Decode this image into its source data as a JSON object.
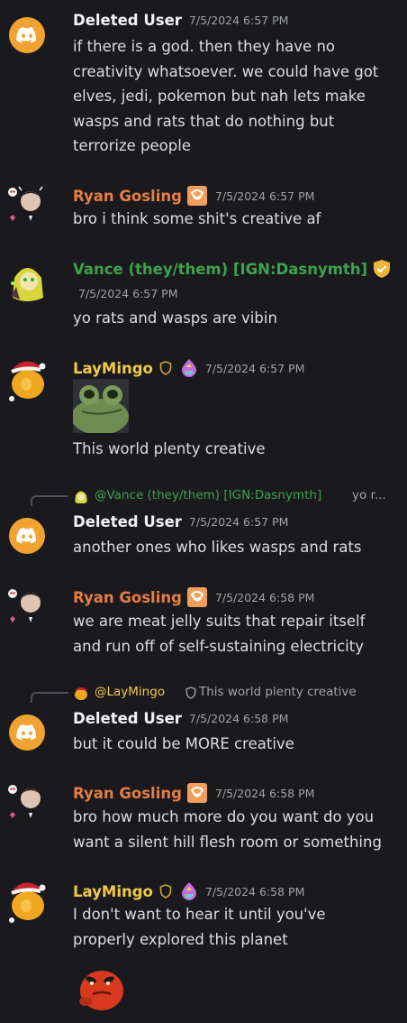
{
  "colors": {
    "background": "#1a1a1e",
    "deleted_user_avatar": "#f0a232",
    "ryan_name": "#e67e43",
    "vance_name": "#3ea24b",
    "laymingo_name": "#f0c94a"
  },
  "messages": [
    {
      "author": "Deleted User",
      "timestamp": "7/5/2024 6:57 PM",
      "lines": [
        "if there is a god. then they have no",
        "creativity whatsoever. we could have got",
        "elves, jedi, pokemon but nah lets make",
        "wasps and rats that do nothing but",
        "terrorize people"
      ]
    },
    {
      "author": "Ryan Gosling",
      "timestamp": "7/5/2024 6:57 PM",
      "lines": [
        "bro i think some shit's creative af"
      ]
    },
    {
      "author": "Vance (they/them) [IGN:Dasnymth]",
      "timestamp": "7/5/2024 6:57 PM",
      "lines": [
        "yo rats and wasps are vibin"
      ]
    },
    {
      "author": "LayMingo",
      "timestamp": "7/5/2024 6:57 PM",
      "lines": [
        "This world plenty creative"
      ],
      "sticker": "frog-sticker"
    },
    {
      "reply_to_name": "@Vance (they/them) [IGN:Dasnymth]",
      "reply_to_text": "yo r...",
      "author": "Deleted User",
      "timestamp": "7/5/2024 6:57 PM",
      "lines": [
        "another ones who likes wasps and rats"
      ]
    },
    {
      "author": "Ryan Gosling",
      "timestamp": "7/5/2024 6:58 PM",
      "lines": [
        "we are meat jelly suits that repair itself",
        "and run off of self-sustaining electricity"
      ]
    },
    {
      "reply_to_name": "@LayMingo",
      "reply_to_text": "This world plenty creative",
      "author": "Deleted User",
      "timestamp": "7/5/2024 6:58 PM",
      "lines": [
        "but it could be MORE creative"
      ]
    },
    {
      "author": "Ryan Gosling",
      "timestamp": "7/5/2024 6:58 PM",
      "lines": [
        "bro how much more do you want do you",
        "want a silent hill flesh room or something"
      ]
    },
    {
      "author": "LayMingo",
      "timestamp": "7/5/2024 6:58 PM",
      "lines": [
        "I don't want to hear it until you've",
        "properly explored this planet"
      ],
      "sticker": "angry-red-creature-sticker"
    }
  ]
}
